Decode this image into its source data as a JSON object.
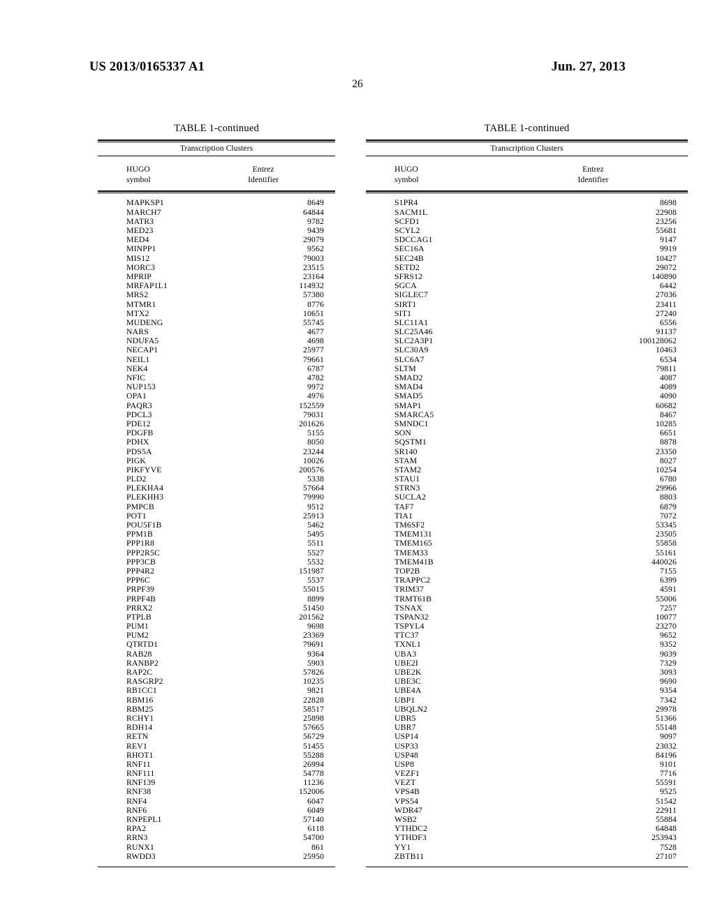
{
  "header": {
    "publication_number": "US 2013/0165337 A1",
    "publication_date": "Jun. 27, 2013",
    "page_number": "26"
  },
  "tables": [
    {
      "caption": "TABLE 1-continued",
      "subhead": "Transcription Clusters",
      "columns": [
        {
          "line1": "HUGO",
          "line2": "symbol"
        },
        {
          "line1": "Entrez",
          "line2": "Identifier"
        }
      ],
      "rows": [
        {
          "symbol": "MAPKSP1",
          "id": "8649"
        },
        {
          "symbol": "MARCH7",
          "id": "64844"
        },
        {
          "symbol": "MATR3",
          "id": "9782"
        },
        {
          "symbol": "MED23",
          "id": "9439"
        },
        {
          "symbol": "MED4",
          "id": "29079"
        },
        {
          "symbol": "MINPP1",
          "id": "9562"
        },
        {
          "symbol": "MIS12",
          "id": "79003"
        },
        {
          "symbol": "MORC3",
          "id": "23515"
        },
        {
          "symbol": "MPRIP",
          "id": "23164"
        },
        {
          "symbol": "MRFAP1L1",
          "id": "114932"
        },
        {
          "symbol": "MRS2",
          "id": "57380"
        },
        {
          "symbol": "MTMR1",
          "id": "8776"
        },
        {
          "symbol": "MTX2",
          "id": "10651"
        },
        {
          "symbol": "MUDENG",
          "id": "55745"
        },
        {
          "symbol": "NARS",
          "id": "4677"
        },
        {
          "symbol": "NDUFA5",
          "id": "4698"
        },
        {
          "symbol": "NECAP1",
          "id": "25977"
        },
        {
          "symbol": "NEIL1",
          "id": "79661"
        },
        {
          "symbol": "NEK4",
          "id": "6787"
        },
        {
          "symbol": "NFIC",
          "id": "4782"
        },
        {
          "symbol": "NUP153",
          "id": "9972"
        },
        {
          "symbol": "OPA1",
          "id": "4976"
        },
        {
          "symbol": "PAQR3",
          "id": "152559"
        },
        {
          "symbol": "PDCL3",
          "id": "79031"
        },
        {
          "symbol": "PDE12",
          "id": "201626"
        },
        {
          "symbol": "PDGFB",
          "id": "5155"
        },
        {
          "symbol": "PDHX",
          "id": "8050"
        },
        {
          "symbol": "PDS5A",
          "id": "23244"
        },
        {
          "symbol": "PIGK",
          "id": "10026"
        },
        {
          "symbol": "PIKFYVE",
          "id": "200576"
        },
        {
          "symbol": "PLD2",
          "id": "5338"
        },
        {
          "symbol": "PLEKHA4",
          "id": "57664"
        },
        {
          "symbol": "PLEKHH3",
          "id": "79990"
        },
        {
          "symbol": "PMPCB",
          "id": "9512"
        },
        {
          "symbol": "POT1",
          "id": "25913"
        },
        {
          "symbol": "POU5F1B",
          "id": "5462"
        },
        {
          "symbol": "PPM1B",
          "id": "5495"
        },
        {
          "symbol": "PPP1R8",
          "id": "5511"
        },
        {
          "symbol": "PPP2R5C",
          "id": "5527"
        },
        {
          "symbol": "PPP3CB",
          "id": "5532"
        },
        {
          "symbol": "PPP4R2",
          "id": "151987"
        },
        {
          "symbol": "PPP6C",
          "id": "5537"
        },
        {
          "symbol": "PRPF39",
          "id": "55015"
        },
        {
          "symbol": "PRPF4B",
          "id": "8899"
        },
        {
          "symbol": "PRRX2",
          "id": "51450"
        },
        {
          "symbol": "PTPLB",
          "id": "201562"
        },
        {
          "symbol": "PUM1",
          "id": "9698"
        },
        {
          "symbol": "PUM2",
          "id": "23369"
        },
        {
          "symbol": "QTRTD1",
          "id": "79691"
        },
        {
          "symbol": "RAB28",
          "id": "9364"
        },
        {
          "symbol": "RANBP2",
          "id": "5903"
        },
        {
          "symbol": "RAP2C",
          "id": "57826"
        },
        {
          "symbol": "RASGRP2",
          "id": "10235"
        },
        {
          "symbol": "RB1CC1",
          "id": "9821"
        },
        {
          "symbol": "RBM16",
          "id": "22828"
        },
        {
          "symbol": "RBM25",
          "id": "58517"
        },
        {
          "symbol": "RCHY1",
          "id": "25898"
        },
        {
          "symbol": "RDH14",
          "id": "57665"
        },
        {
          "symbol": "RETN",
          "id": "56729"
        },
        {
          "symbol": "REV1",
          "id": "51455"
        },
        {
          "symbol": "RHOT1",
          "id": "55288"
        },
        {
          "symbol": "RNF11",
          "id": "26994"
        },
        {
          "symbol": "RNF111",
          "id": "54778"
        },
        {
          "symbol": "RNF139",
          "id": "11236"
        },
        {
          "symbol": "RNF38",
          "id": "152006"
        },
        {
          "symbol": "RNF4",
          "id": "6047"
        },
        {
          "symbol": "RNF6",
          "id": "6049"
        },
        {
          "symbol": "RNPEPL1",
          "id": "57140"
        },
        {
          "symbol": "RPA2",
          "id": "6118"
        },
        {
          "symbol": "RRN3",
          "id": "54700"
        },
        {
          "symbol": "RUNX1",
          "id": "861"
        },
        {
          "symbol": "RWDD3",
          "id": "25950"
        }
      ]
    },
    {
      "caption": "TABLE 1-continued",
      "subhead": "Transcription Clusters",
      "columns": [
        {
          "line1": "HUGO",
          "line2": "symbol"
        },
        {
          "line1": "Entrez",
          "line2": "Identifier"
        }
      ],
      "rows": [
        {
          "symbol": "S1PR4",
          "id": "8698"
        },
        {
          "symbol": "SACM1L",
          "id": "22908"
        },
        {
          "symbol": "SCFD1",
          "id": "23256"
        },
        {
          "symbol": "SCYL2",
          "id": "55681"
        },
        {
          "symbol": "SDCCAG1",
          "id": "9147"
        },
        {
          "symbol": "SEC16A",
          "id": "9919"
        },
        {
          "symbol": "SEC24B",
          "id": "10427"
        },
        {
          "symbol": "SETD2",
          "id": "29072"
        },
        {
          "symbol": "SFRS12",
          "id": "140890"
        },
        {
          "symbol": "SGCA",
          "id": "6442"
        },
        {
          "symbol": "SIGLEC7",
          "id": "27036"
        },
        {
          "symbol": "SIRT1",
          "id": "23411"
        },
        {
          "symbol": "SIT1",
          "id": "27240"
        },
        {
          "symbol": "SLC11A1",
          "id": "6556"
        },
        {
          "symbol": "SLC25A46",
          "id": "91137"
        },
        {
          "symbol": "SLC2A3P1",
          "id": "100128062"
        },
        {
          "symbol": "SLC30A9",
          "id": "10463"
        },
        {
          "symbol": "SLC6A7",
          "id": "6534"
        },
        {
          "symbol": "SLTM",
          "id": "79811"
        },
        {
          "symbol": "SMAD2",
          "id": "4087"
        },
        {
          "symbol": "SMAD4",
          "id": "4089"
        },
        {
          "symbol": "SMAD5",
          "id": "4090"
        },
        {
          "symbol": "SMAP1",
          "id": "60682"
        },
        {
          "symbol": "SMARCA5",
          "id": "8467"
        },
        {
          "symbol": "SMNDC1",
          "id": "10285"
        },
        {
          "symbol": "SON",
          "id": "6651"
        },
        {
          "symbol": "SQSTM1",
          "id": "8878"
        },
        {
          "symbol": "SR140",
          "id": "23350"
        },
        {
          "symbol": "STAM",
          "id": "8027"
        },
        {
          "symbol": "STAM2",
          "id": "10254"
        },
        {
          "symbol": "STAU1",
          "id": "6780"
        },
        {
          "symbol": "STRN3",
          "id": "29966"
        },
        {
          "symbol": "SUCLA2",
          "id": "8803"
        },
        {
          "symbol": "TAF7",
          "id": "6879"
        },
        {
          "symbol": "TIA1",
          "id": "7072"
        },
        {
          "symbol": "TM6SF2",
          "id": "53345"
        },
        {
          "symbol": "TMEM131",
          "id": "23505"
        },
        {
          "symbol": "TMEM165",
          "id": "55858"
        },
        {
          "symbol": "TMEM33",
          "id": "55161"
        },
        {
          "symbol": "TMEM41B",
          "id": "440026"
        },
        {
          "symbol": "TOP2B",
          "id": "7155"
        },
        {
          "symbol": "TRAPPC2",
          "id": "6399"
        },
        {
          "symbol": "TRIM37",
          "id": "4591"
        },
        {
          "symbol": "TRMT61B",
          "id": "55006"
        },
        {
          "symbol": "TSNAX",
          "id": "7257"
        },
        {
          "symbol": "TSPAN32",
          "id": "10077"
        },
        {
          "symbol": "TSPYL4",
          "id": "23270"
        },
        {
          "symbol": "TTC37",
          "id": "9652"
        },
        {
          "symbol": "TXNL1",
          "id": "9352"
        },
        {
          "symbol": "UBA3",
          "id": "9039"
        },
        {
          "symbol": "UBE2I",
          "id": "7329"
        },
        {
          "symbol": "UBE2K",
          "id": "3093"
        },
        {
          "symbol": "UBE3C",
          "id": "9690"
        },
        {
          "symbol": "UBE4A",
          "id": "9354"
        },
        {
          "symbol": "UBP1",
          "id": "7342"
        },
        {
          "symbol": "UBQLN2",
          "id": "29978"
        },
        {
          "symbol": "UBR5",
          "id": "51366"
        },
        {
          "symbol": "UBR7",
          "id": "55148"
        },
        {
          "symbol": "USP14",
          "id": "9097"
        },
        {
          "symbol": "USP33",
          "id": "23032"
        },
        {
          "symbol": "USP48",
          "id": "84196"
        },
        {
          "symbol": "USP8",
          "id": "9101"
        },
        {
          "symbol": "VEZF1",
          "id": "7716"
        },
        {
          "symbol": "VEZT",
          "id": "55591"
        },
        {
          "symbol": "VPS4B",
          "id": "9525"
        },
        {
          "symbol": "VPS54",
          "id": "51542"
        },
        {
          "symbol": "WDR47",
          "id": "22911"
        },
        {
          "symbol": "WSB2",
          "id": "55884"
        },
        {
          "symbol": "YTHDC2",
          "id": "64848"
        },
        {
          "symbol": "YTHDF3",
          "id": "253943"
        },
        {
          "symbol": "YY1",
          "id": "7528"
        },
        {
          "symbol": "ZBTB11",
          "id": "27107"
        }
      ]
    }
  ]
}
